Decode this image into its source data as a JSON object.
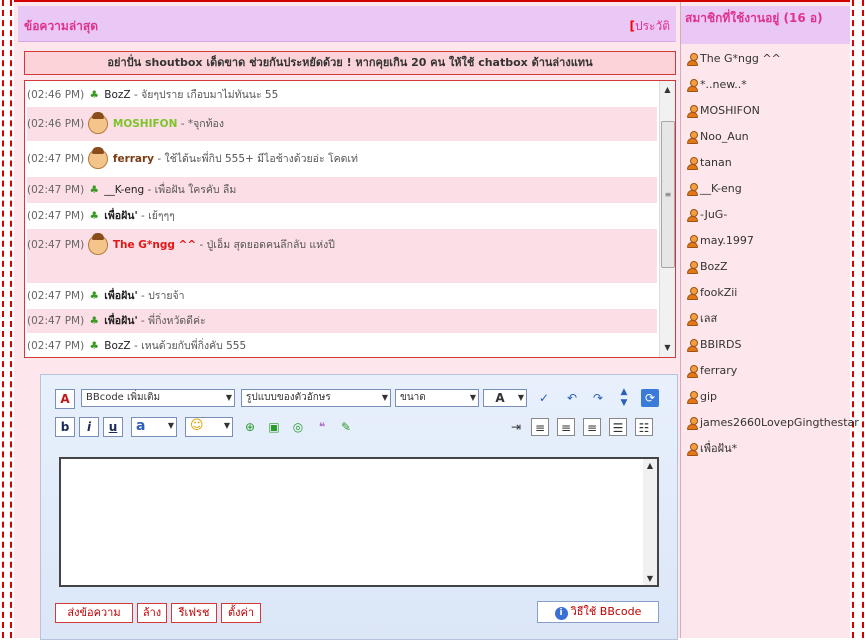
{
  "header": {
    "title": "ข้อความล่าสุด",
    "history_label": "ประวัติ"
  },
  "sidebar": {
    "title": "สมาชิกที่ใช้งานอยู่ (16 อ)",
    "users": [
      "The G*ngg ^^",
      "*..new..*",
      "MOSHIFON",
      "Noo_Aun",
      "tanan",
      "__K-eng",
      "-JuG-",
      "may.1997",
      "BozZ",
      "fookZii",
      "เลส",
      "BBIRDS",
      "ferrary",
      "gip",
      "james2660LovepGingthestar",
      "เพื่อฝัน*"
    ]
  },
  "notice": "อย่าปั่น shoutbox เด็ดขาด ช่วยกันประหยัดด้วย ! หากคุยเกิน 20 คน ให้ใช้ chatbox ด้านล่างแทน",
  "messages": [
    {
      "time": "(02:46 PM)",
      "user": "BozZ",
      "text": "- จัยๆปราย เกือบมาไม่ทันนะ 55"
    },
    {
      "time": "(02:46 PM)",
      "user": "MOSHIFON",
      "text": "- *จุกท้อง"
    },
    {
      "time": "(02:47 PM)",
      "user": "ferrary",
      "text": "- ใช้ได้นะพี่กิป 555+ มีไอช้างด้วยอ่ะ โคดเท่"
    },
    {
      "time": "(02:47 PM)",
      "user": "__K-eng",
      "text": "- เพื่อฝัน ใครคับ ลืม"
    },
    {
      "time": "(02:47 PM)",
      "user": "เพื่อฝัน'",
      "text": "- เย้ๆๆๆ"
    },
    {
      "time": "(02:47 PM)",
      "user": "The G*ngg ^^",
      "text": "- ปู่เอ็ม สุดยอดคนลึกลับ แห่งปี"
    },
    {
      "time": "(02:47 PM)",
      "user": "เพื่อฝัน'",
      "text": "- ปรายจ้า"
    },
    {
      "time": "(02:47 PM)",
      "user": "เพื่อฝัน'",
      "text": "- พี่กิ่งหวัดดีค่ะ"
    },
    {
      "time": "(02:47 PM)",
      "user": "BozZ",
      "text": "- เหนด้วยกับพี่กิ่งคับ 555"
    }
  ],
  "editor": {
    "bbcode_select": "BBcode เพิ่มเติม",
    "font_select": "รูปแบบของตัวอักษร",
    "size_select": "ขนาด",
    "color_button": "A",
    "bold": "b",
    "italic": "i",
    "underline": "u",
    "highlight_button": "a",
    "buttons": {
      "send": "ส่งข้อความ",
      "clear": "ล้าง",
      "refresh": "รีเฟรช",
      "settings": "ตั้งค่า"
    },
    "bbcode_help": "วิธีใช้ BBcode"
  }
}
